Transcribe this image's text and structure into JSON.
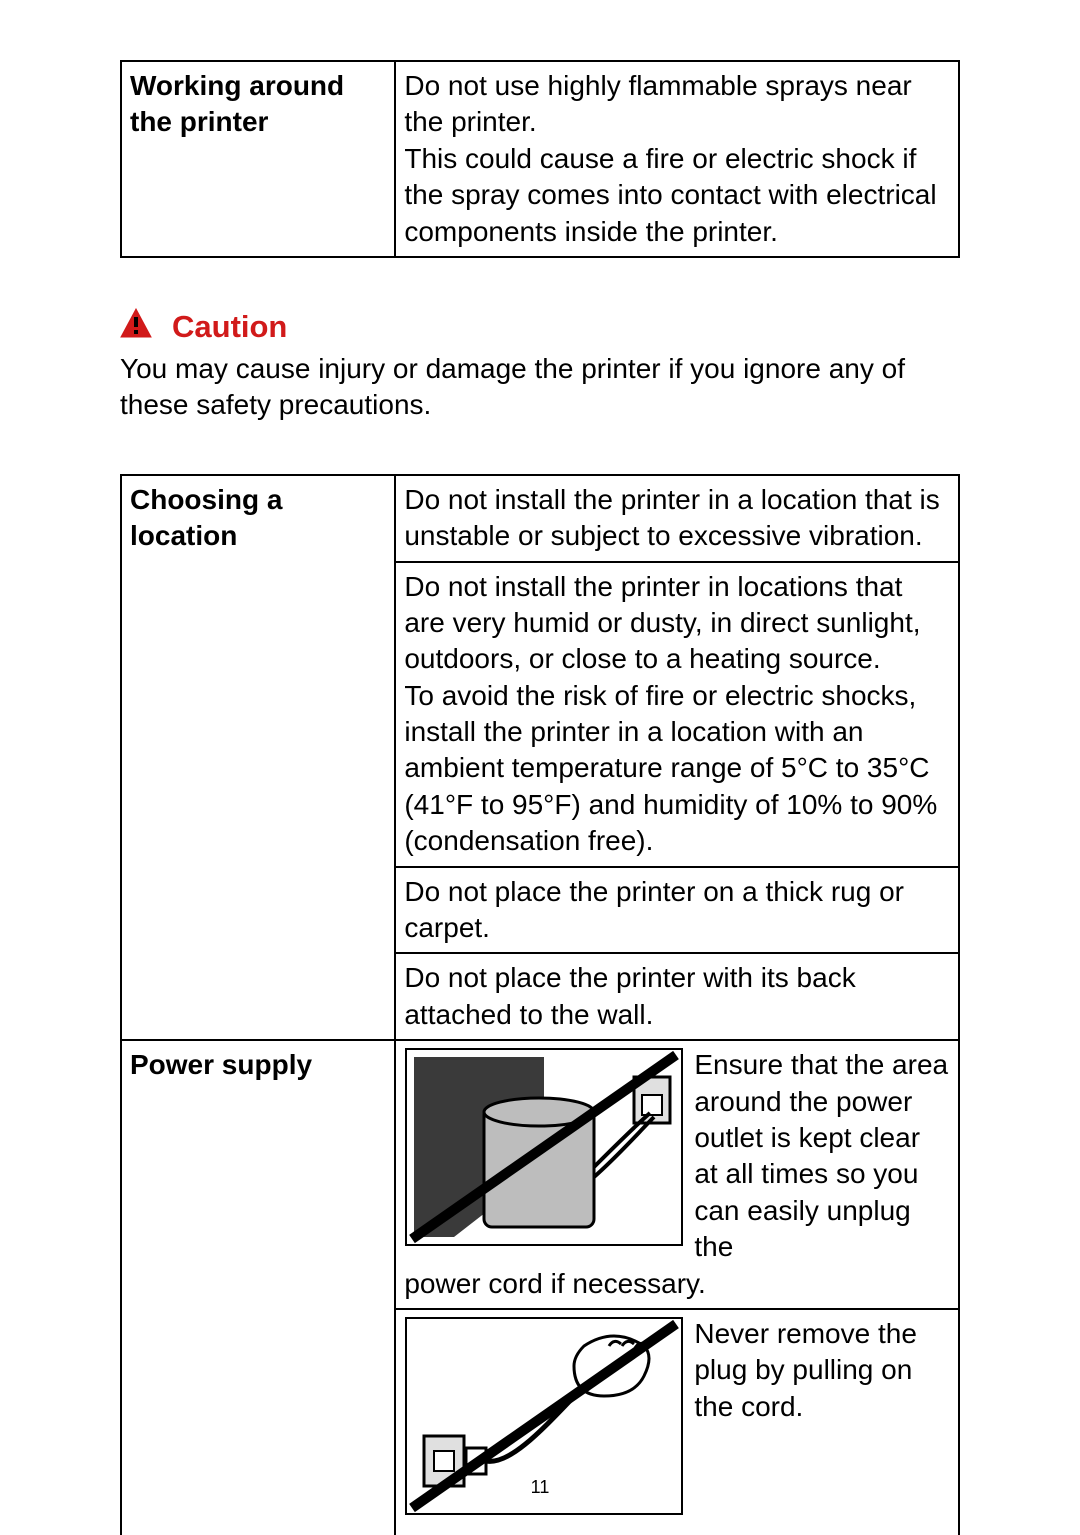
{
  "top_table": {
    "heading": "Working around the printer",
    "body": "Do not use highly flammable sprays near the printer.\nThis could cause a fire or electric shock if the spray comes into contact with electrical components inside the printer."
  },
  "caution": {
    "title": "Caution",
    "body": "You may cause injury or damage the printer if you ignore any of these safety precautions."
  },
  "main_table": {
    "rows": [
      {
        "heading": "Choosing a location",
        "cells": [
          "Do not install the printer in a location that is unstable or subject to excessive vibration.",
          "Do not install the printer in locations that are very humid or dusty, in direct sunlight, outdoors, or close to a heating source.\nTo avoid the risk of fire or electric shocks, install the printer in a location with an ambient temperature range of 5°C to 35°C (41°F to 95°F) and humidity of 10% to 90% (condensation free).",
          "Do not place the printer on a thick rug or carpet.",
          "Do not place the printer with its back attached to the wall."
        ]
      },
      {
        "heading": "Power supply",
        "cells": [
          {
            "right_text": "Ensure that the area around the power outlet is kept clear at all times so you can easily unplug the",
            "bottom_text": "power cord if necessary.",
            "illustration": "printer-cord-blocked-icon"
          },
          {
            "right_text": "Never remove the plug by pulling on the cord.",
            "illustration": "pull-cord-hand-icon"
          }
        ]
      }
    ]
  },
  "page_number": "11"
}
